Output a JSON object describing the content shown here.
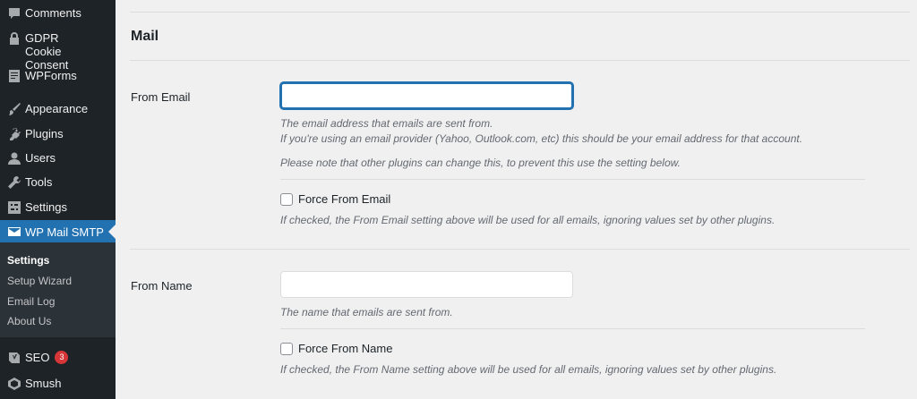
{
  "sidebar": {
    "items": [
      {
        "label": "Comments",
        "icon": "comment-icon"
      },
      {
        "label": "GDPR Cookie Consent",
        "icon": "lock-icon"
      },
      {
        "label": "WPForms",
        "icon": "form-icon"
      },
      {
        "label": "Appearance",
        "icon": "brush-icon"
      },
      {
        "label": "Plugins",
        "icon": "plug-icon"
      },
      {
        "label": "Users",
        "icon": "user-icon"
      },
      {
        "label": "Tools",
        "icon": "wrench-icon"
      },
      {
        "label": "Settings",
        "icon": "settings-icon"
      },
      {
        "label": "WP Mail SMTP",
        "icon": "mail-icon"
      },
      {
        "label": "SEO",
        "icon": "yoast-icon",
        "badge": "3"
      },
      {
        "label": "Smush",
        "icon": "smush-icon"
      }
    ],
    "submenu": [
      {
        "label": "Settings"
      },
      {
        "label": "Setup Wizard"
      },
      {
        "label": "Email Log"
      },
      {
        "label": "About Us"
      }
    ],
    "colors": {
      "background": "#1d2327",
      "active": "#2271b1",
      "submenu": "#2c3338",
      "badge": "#d63638"
    }
  },
  "main": {
    "section_title": "Mail",
    "from_email": {
      "label": "From Email",
      "value": "",
      "desc_line1": "The email address that emails are sent from.",
      "desc_line2": "If you're using an email provider (Yahoo, Outlook.com, etc) this should be your email address for that account.",
      "desc_note": "Please note that other plugins can change this, to prevent this use the setting below.",
      "force_label": "Force From Email",
      "force_checked": false,
      "force_desc": "If checked, the From Email setting above will be used for all emails, ignoring values set by other plugins."
    },
    "from_name": {
      "label": "From Name",
      "value": "",
      "desc": "The name that emails are sent from.",
      "force_label": "Force From Name",
      "force_checked": false,
      "force_desc": "If checked, the From Name setting above will be used for all emails, ignoring values set by other plugins."
    }
  }
}
